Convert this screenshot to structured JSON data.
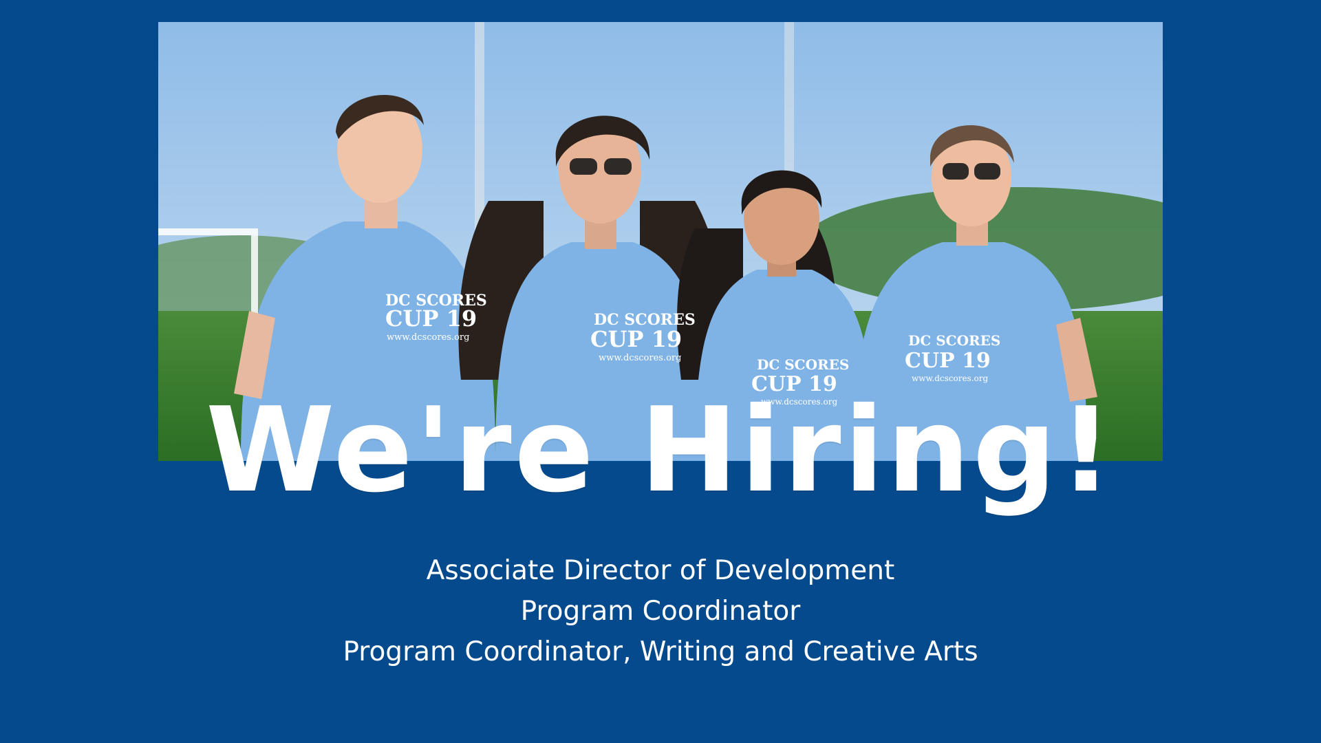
{
  "banner": {
    "headline": "We're Hiring!",
    "positions": [
      "Associate Director of Development",
      "Program Coordinator",
      "Program Coordinator, Writing and Creative Arts"
    ],
    "photo": {
      "shirt_brand": "DC SCORES",
      "shirt_event": "CUP 19",
      "shirt_url": "www.dcscores.org"
    }
  },
  "colors": {
    "background": "#054a8c",
    "shirt": "#7fb3e6",
    "text": "#ffffff"
  }
}
